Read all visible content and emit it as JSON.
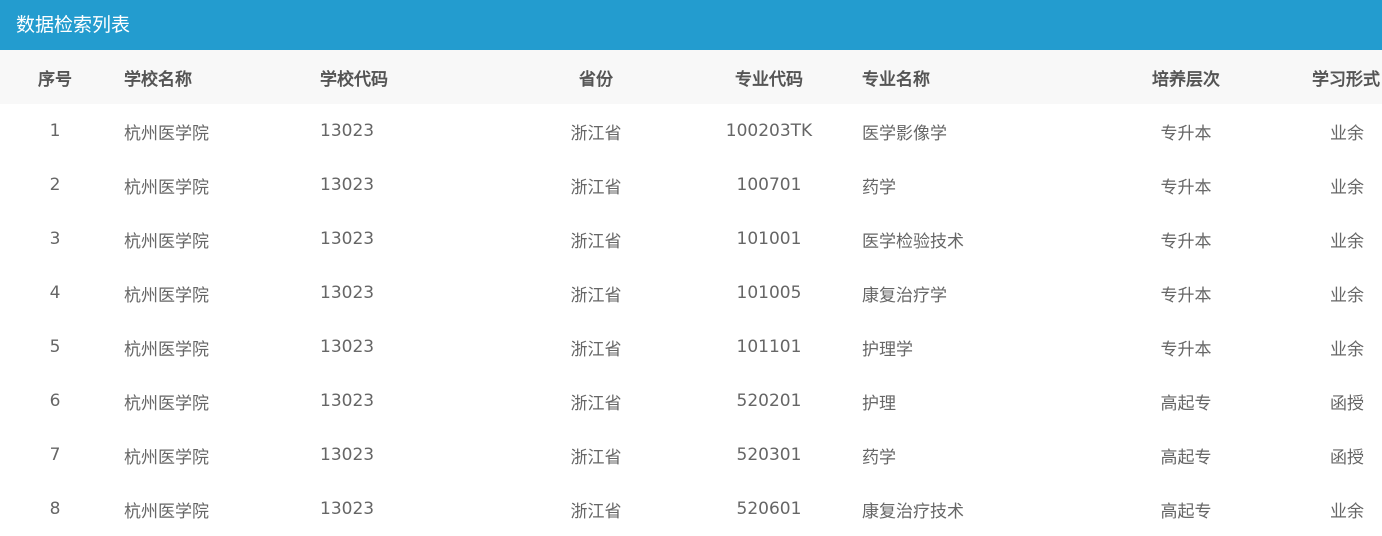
{
  "header": {
    "title": "数据检索列表"
  },
  "table": {
    "columns": [
      "序号",
      "学校名称",
      "学校代码",
      "省份",
      "专业代码",
      "专业名称",
      "培养层次",
      "学习形式"
    ],
    "rows": [
      [
        "1",
        "杭州医学院",
        "13023",
        "浙江省",
        "100203TK",
        "医学影像学",
        "专升本",
        "业余"
      ],
      [
        "2",
        "杭州医学院",
        "13023",
        "浙江省",
        "100701",
        "药学",
        "专升本",
        "业余"
      ],
      [
        "3",
        "杭州医学院",
        "13023",
        "浙江省",
        "101001",
        "医学检验技术",
        "专升本",
        "业余"
      ],
      [
        "4",
        "杭州医学院",
        "13023",
        "浙江省",
        "101005",
        "康复治疗学",
        "专升本",
        "业余"
      ],
      [
        "5",
        "杭州医学院",
        "13023",
        "浙江省",
        "101101",
        "护理学",
        "专升本",
        "业余"
      ],
      [
        "6",
        "杭州医学院",
        "13023",
        "浙江省",
        "520201",
        "护理",
        "高起专",
        "函授"
      ],
      [
        "7",
        "杭州医学院",
        "13023",
        "浙江省",
        "520301",
        "药学",
        "高起专",
        "函授"
      ],
      [
        "8",
        "杭州医学院",
        "13023",
        "浙江省",
        "520601",
        "康复治疗技术",
        "高起专",
        "业余"
      ]
    ]
  },
  "colors": {
    "header_bg": "#239ccf",
    "header_text": "#ffffff",
    "table_head_bg": "#f8f8f8",
    "text": "#666666"
  }
}
